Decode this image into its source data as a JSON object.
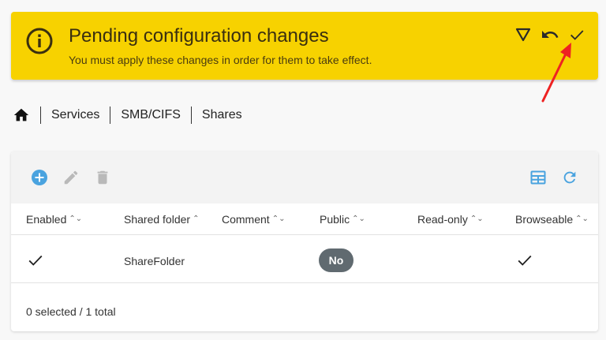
{
  "banner": {
    "title": "Pending configuration changes",
    "subtitle": "You must apply these changes in order for them to take effect.",
    "background": "#f7d200",
    "icons": [
      "info-icon",
      "filter-icon",
      "undo-icon",
      "check-icon"
    ]
  },
  "breadcrumb": {
    "home_icon": "home-icon",
    "items": [
      "Services",
      "SMB/CIFS",
      "Shares"
    ]
  },
  "toolbar": {
    "icons": [
      "add-icon",
      "edit-icon",
      "delete-icon",
      "columns-icon",
      "refresh-icon"
    ],
    "accent": "#4aa3df"
  },
  "table": {
    "columns": [
      {
        "label": "Enabled",
        "sort": "⌃⌄"
      },
      {
        "label": "Shared folder",
        "sort": "⌃"
      },
      {
        "label": "Comment",
        "sort": "⌃⌄"
      },
      {
        "label": "Public",
        "sort": "⌃⌄"
      },
      {
        "label": "Read-only",
        "sort": "⌃⌄"
      },
      {
        "label": "Browseable",
        "sort": "⌃⌄"
      }
    ],
    "rows": [
      {
        "enabled": true,
        "shared_folder": "ShareFolder",
        "comment": "",
        "public": "No",
        "read_only": false,
        "browseable": true
      }
    ],
    "footer": "0 selected / 1 total"
  }
}
